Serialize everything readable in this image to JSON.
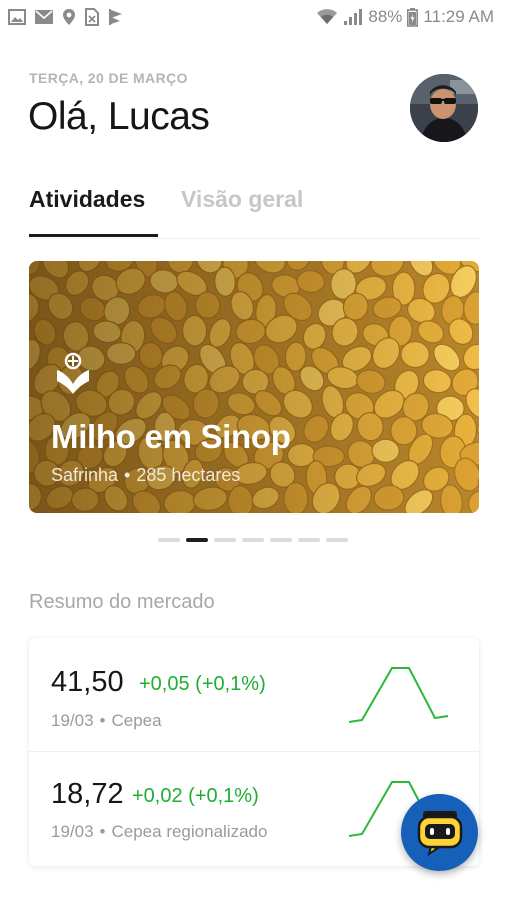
{
  "status_bar": {
    "battery": "88%",
    "time": "11:29 AM",
    "left_icons": [
      "gallery-icon",
      "mail-icon",
      "location-icon",
      "no-sim-icon",
      "flag-icon"
    ],
    "right_icons": [
      "wifi-icon",
      "signal-icon",
      "battery-icon"
    ]
  },
  "header": {
    "date": "TERÇA, 20 DE MARÇO",
    "greeting": "Olá, Lucas"
  },
  "tabs": [
    {
      "label": "Atividades",
      "active": true
    },
    {
      "label": "Visão geral",
      "active": false
    }
  ],
  "activity_card": {
    "icon": "crop-icon",
    "title": "Milho em Sinop",
    "season": "Safrinha",
    "separator": "•",
    "area": "285 hectares"
  },
  "carousel": {
    "count": 7,
    "active_index": 1
  },
  "market": {
    "title": "Resumo do mercado",
    "quotes": [
      {
        "value": "41,50",
        "change": "+0,05 (+0,1%)",
        "date": "19/03",
        "separator": "•",
        "source": "Cepea"
      },
      {
        "value": "18,72",
        "change": "+0,02 (+0,1%)",
        "date": "19/03",
        "separator": "•",
        "source": "Cepea regionalizado"
      }
    ],
    "positive_color": "#1fae32"
  },
  "assistant_fab": {
    "icon": "robot-assistant-icon",
    "color": "#1760b9"
  }
}
